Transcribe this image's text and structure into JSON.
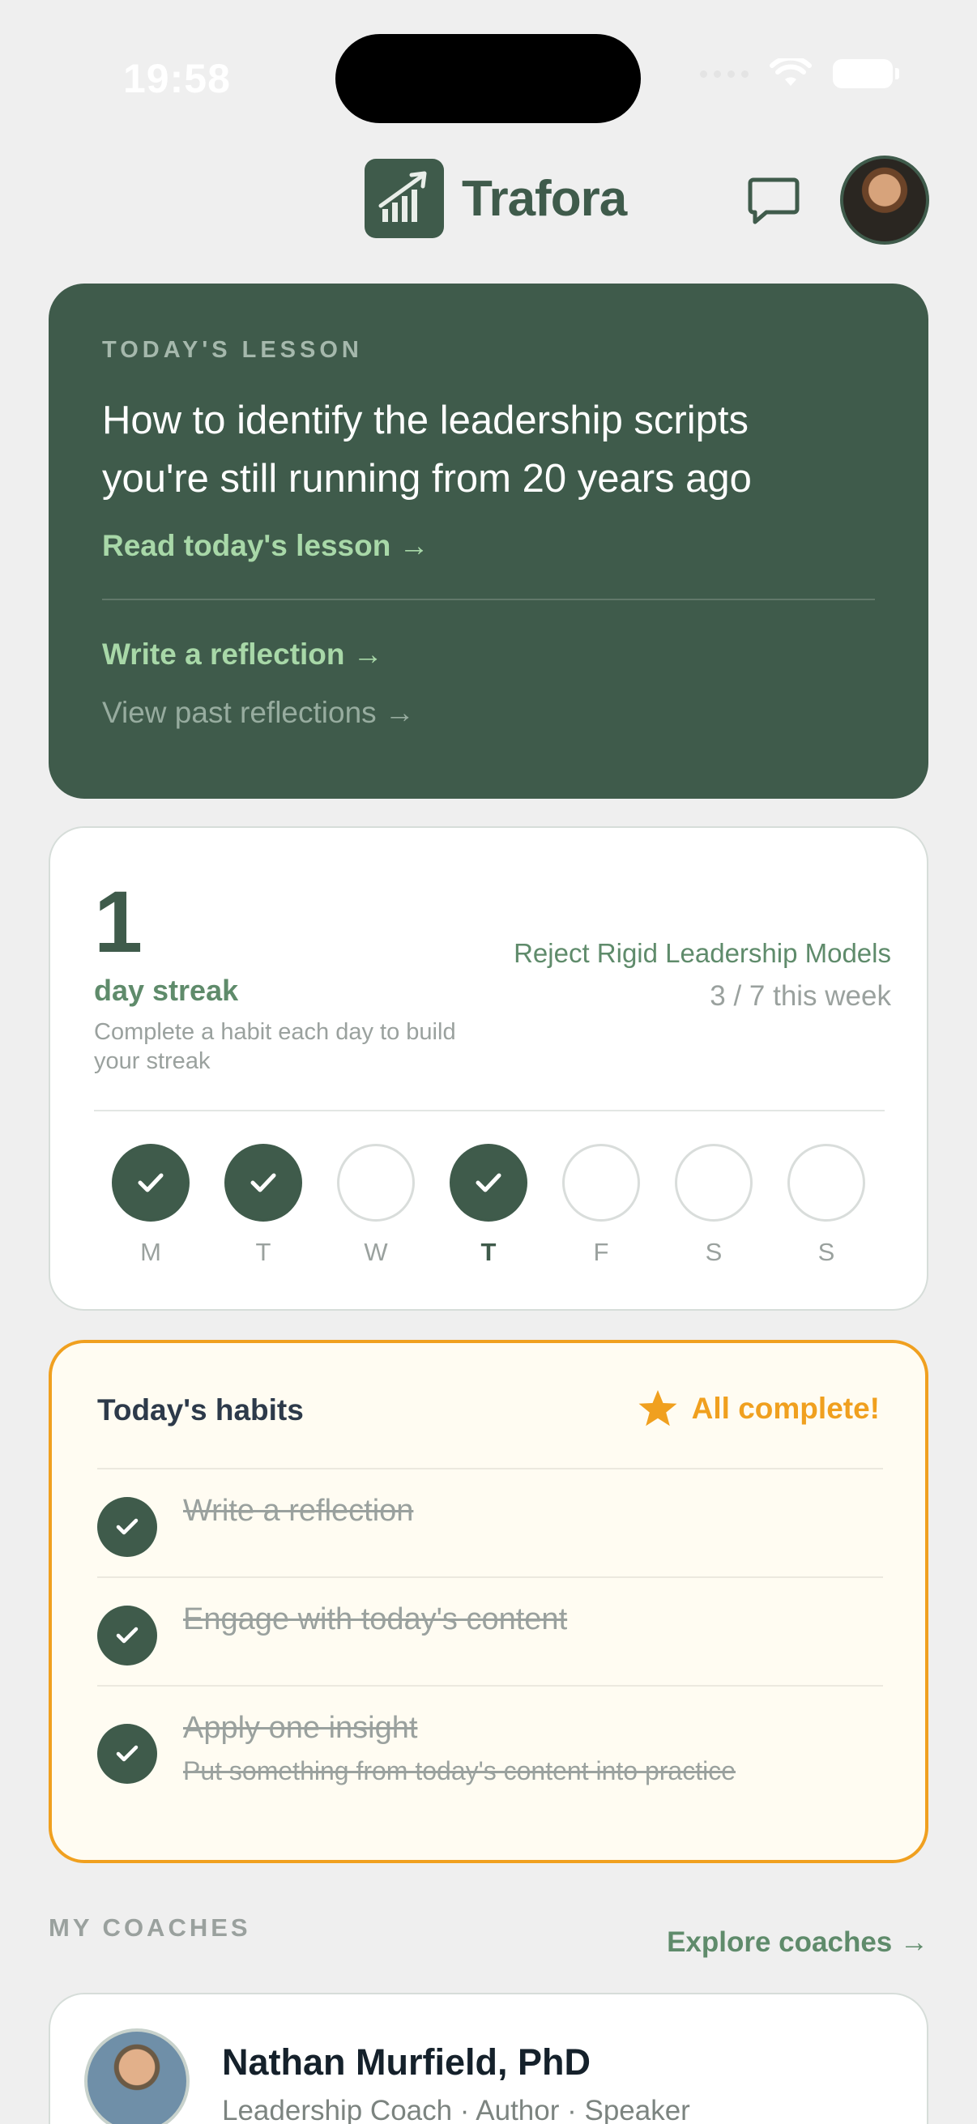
{
  "status_bar": {
    "time": "19:58"
  },
  "header": {
    "app_name": "Trafora"
  },
  "lesson": {
    "kicker": "TODAY'S LESSON",
    "title": "How to identify the leadership scripts you're still running from 20 years ago",
    "read_link": "Read today's lesson →",
    "reflect_link": "Write a reflection →",
    "past_link": "View past reflections →"
  },
  "streak": {
    "count": "1",
    "label": "day streak",
    "hint": "Complete a habit each day to build your streak",
    "habit_name": "Reject Rigid Leadership Models",
    "week_progress": "3 / 7 this week",
    "days": [
      {
        "label": "M",
        "done": true
      },
      {
        "label": "T",
        "done": true
      },
      {
        "label": "W",
        "done": false
      },
      {
        "label": "T",
        "done": true,
        "today": true
      },
      {
        "label": "F",
        "done": false
      },
      {
        "label": "S",
        "done": false
      },
      {
        "label": "S",
        "done": false
      }
    ]
  },
  "habits": {
    "title": "Today's habits",
    "status": "All complete!",
    "items": [
      {
        "text": "Write a reflection",
        "done": true
      },
      {
        "text": "Engage with today's content",
        "done": true
      },
      {
        "text": "Apply one insight",
        "sub": "Put something from today's content into practice",
        "done": true
      }
    ]
  },
  "coaches": {
    "heading": "MY COACHES",
    "explore_link": "Explore coaches →",
    "items": [
      {
        "name": "Nathan Murfield, PhD",
        "role": "Leadership Coach · Author · Speaker"
      }
    ]
  },
  "colors": {
    "brand": "#3f5b4b",
    "accent_link": "#a8d8a8",
    "highlight": "#f0a01f"
  }
}
